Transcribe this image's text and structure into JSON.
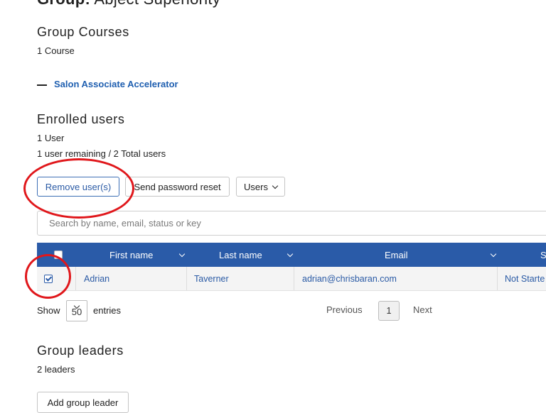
{
  "group": {
    "prefix": "Group:",
    "name": "Abject Superiority"
  },
  "courses": {
    "heading": "Group Courses",
    "count": "1 Course",
    "items": [
      "Salon Associate Accelerator"
    ]
  },
  "enrolled": {
    "heading": "Enrolled users",
    "count": "1 User",
    "remaining": "1 user remaining / 2 Total users"
  },
  "actions": {
    "remove": "Remove user(s)",
    "reset": "Send password reset",
    "users": "Users"
  },
  "search": {
    "placeholder": "Search by name, email, status or key"
  },
  "table": {
    "columns": [
      "First name",
      "Last name",
      "Email",
      "S"
    ],
    "rows": [
      {
        "checked": true,
        "first": "Adrian",
        "last": "Taverner",
        "email": "adrian@chrisbaran.com",
        "status": "Not Starte"
      }
    ]
  },
  "length": {
    "show": "Show",
    "value": "50",
    "entries": "entries"
  },
  "pagination": {
    "previous": "Previous",
    "page": "1",
    "next": "Next"
  },
  "leaders": {
    "heading": "Group leaders",
    "count": "2 leaders",
    "add_button": "Add group leader"
  },
  "annotation_color": "#e0171b",
  "accent_color": "#2a5ba8"
}
